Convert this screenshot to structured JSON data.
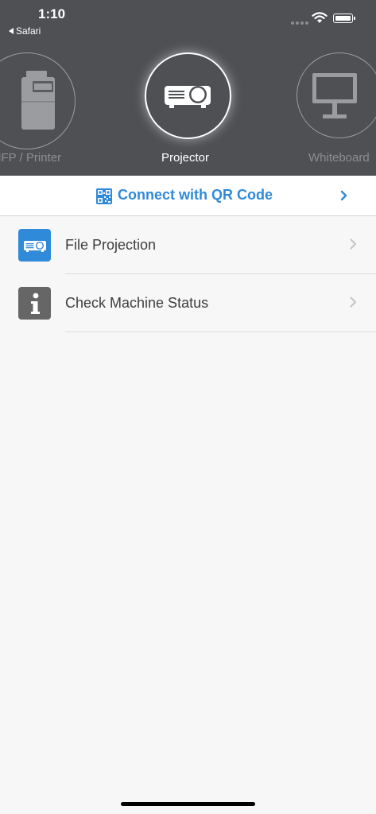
{
  "status_bar": {
    "time": "1:10",
    "back_label": "Safari"
  },
  "devices": [
    {
      "label": "MFP / Printer",
      "icon": "printer-icon",
      "selected": false
    },
    {
      "label": "Projector",
      "icon": "projector-icon",
      "selected": true
    },
    {
      "label": "Whiteboard",
      "icon": "whiteboard-icon",
      "selected": false
    }
  ],
  "qr": {
    "label": "Connect with QR Code",
    "icon": "qr-code-icon"
  },
  "menu": [
    {
      "label": "File Projection",
      "icon": "projector-icon"
    },
    {
      "label": "Check Machine Status",
      "icon": "info-icon"
    }
  ],
  "colors": {
    "header_bg": "#4e5054",
    "accent": "#2f8ad9",
    "status_icon_bg": "#666666",
    "page_bg": "#f7f7f7"
  }
}
